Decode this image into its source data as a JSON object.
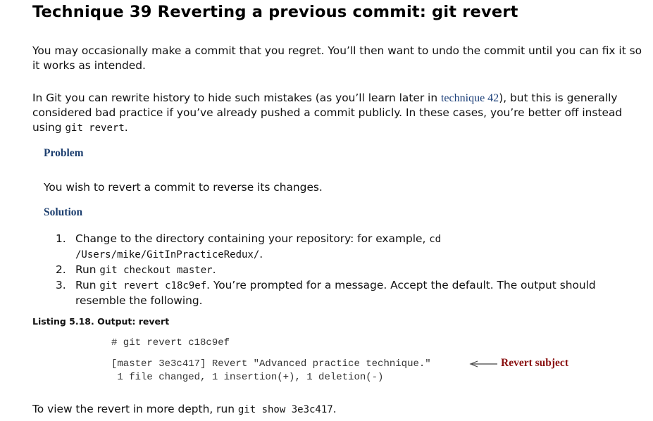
{
  "title": "Technique 39 Reverting a previous commit: git revert",
  "intro": {
    "p1": "You may occasionally make a commit that you regret. You’ll then want to undo the commit until you can fix it so it works as intended.",
    "p2_a": "In Git you can rewrite history to hide such mistakes (as you’ll learn later in ",
    "p2_link": "technique 42",
    "p2_b": "), but this is generally considered bad practice if you’ve already pushed a commit publicly. In these cases, you’re better off instead using ",
    "p2_code": "git revert",
    "p2_c": "."
  },
  "problem": {
    "heading": "Problem",
    "text": "You wish to revert a commit to reverse its changes."
  },
  "solution": {
    "heading": "Solution",
    "steps": [
      {
        "num": "1.",
        "text_a": "Change to the directory containing your repository: for example, ",
        "code": "cd /Users/mike/GitInPracticeRedux/",
        "text_b": "."
      },
      {
        "num": "2.",
        "text_a": "Run ",
        "code": "git checkout master",
        "text_b": "."
      },
      {
        "num": "3.",
        "text_a": "Run ",
        "code": "git revert c18c9ef",
        "text_b": ". You’re prompted for a message. Accept the default. The output should resemble the following."
      }
    ]
  },
  "listing": {
    "title": "Listing 5.18. Output: revert",
    "line1": "# git revert c18c9ef",
    "line2": "[master 3e3c417] Revert \"Advanced practice technique.\"",
    "line3": " 1 file changed, 1 insertion(+), 1 deletion(-)",
    "callout": "Revert subject"
  },
  "footer": {
    "text_a": "To view the revert in more depth, run ",
    "code": "git show 3e3c417",
    "text_b": "."
  }
}
